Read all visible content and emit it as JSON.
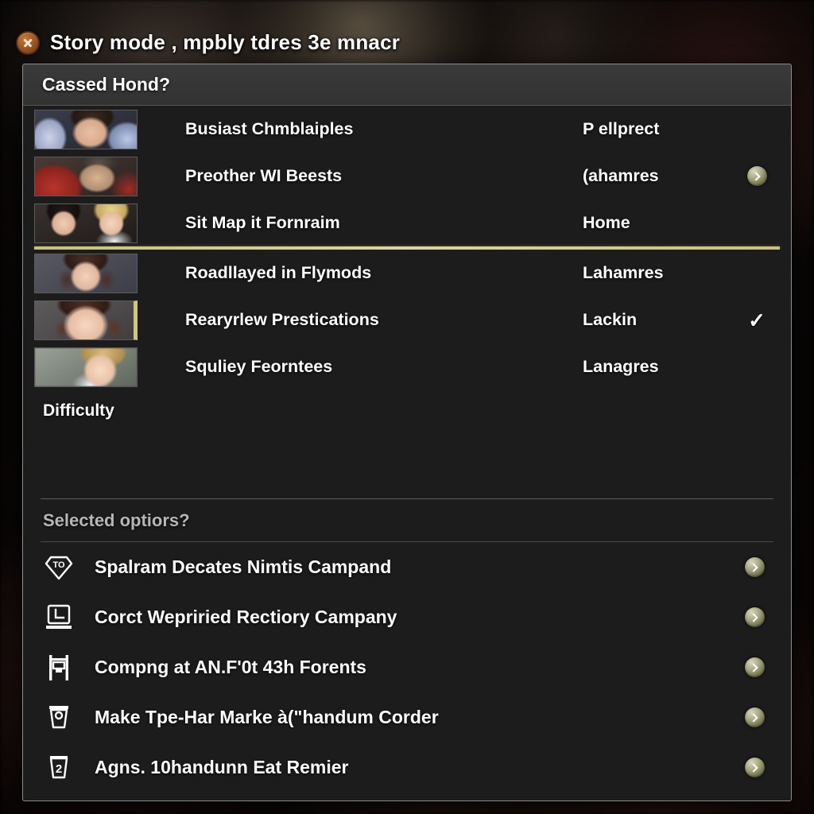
{
  "window": {
    "title": "Story mode , mpbly tdres 3e mnacr",
    "close_icon": "close-x-icon"
  },
  "panel": {
    "header_title": "Cassed Hond?"
  },
  "character_list": {
    "rows": [
      {
        "label": "Busiast Chmblaiples",
        "value": "P ellprect",
        "end": "none",
        "portrait": "pa1",
        "selected_right": false
      },
      {
        "label": "Preother WI Beests",
        "value": "(ahamres",
        "end": "arrow",
        "portrait": "pa2",
        "selected_right": false
      },
      {
        "label": "Sit Map it Fornraim",
        "value": "Home",
        "end": "none",
        "portrait": "pa3",
        "selected_right": false
      },
      {
        "label": "Roadllayed in Flymods",
        "value": "Lahamres",
        "end": "none",
        "portrait": "pa4",
        "selected_right": false
      },
      {
        "label": "Rearyrlew Prestications",
        "value": "Lackin",
        "end": "check",
        "portrait": "pa5",
        "selected_right": true
      },
      {
        "label": "Squliey Feorntees",
        "value": "Lanagres",
        "end": "none",
        "portrait": "pa6",
        "selected_right": false
      }
    ],
    "difficulty_label": "Difficulty"
  },
  "options": {
    "section_title": "Selected optiors?",
    "rows": [
      {
        "icon": "diamond-to-icon",
        "label": "Spalram Decates Nimtis Campand",
        "end": "arrow"
      },
      {
        "icon": "monitor-l-icon",
        "label": "Corct Wepriried Rectiory Campany",
        "end": "arrow"
      },
      {
        "icon": "flag-banner-icon",
        "label": "Compng at AN.F'0t 43h Forents",
        "end": "arrow"
      },
      {
        "icon": "cup-circle-icon",
        "label": "Make Tpe-Har Marke à(\"handum Corder",
        "end": "arrow"
      },
      {
        "icon": "cup-two-icon",
        "label": "Agns. 10handunn Eat Remier",
        "end": "arrow"
      }
    ]
  },
  "colors": {
    "panel_bg": "#1c1c1c",
    "panel_border": "#8d8d8d",
    "header_bg": "#333333",
    "accent_yellow": "#cfc77a",
    "arrow_olive": "#8a8a5e",
    "close_orange": "#9c5722",
    "text_primary": "#ffffff",
    "text_muted": "#b6b6b6"
  }
}
